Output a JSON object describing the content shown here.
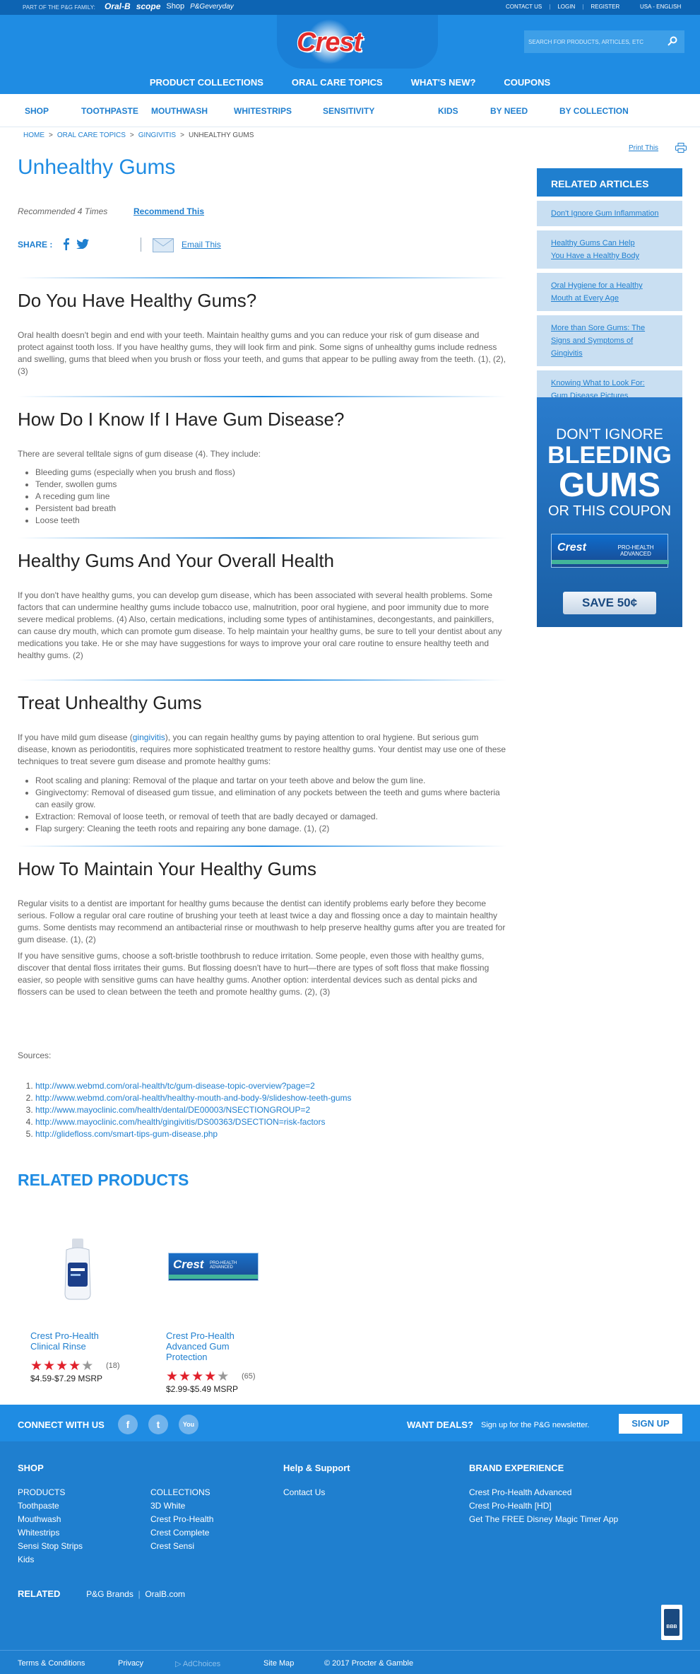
{
  "topbar": {
    "family": "PART OF THE P&G FAMILY:",
    "brands": [
      "Oral-B",
      "scope",
      "Shop",
      "P&Geveryday"
    ],
    "util": [
      "CONTACT US",
      "LOGIN",
      "REGISTER"
    ],
    "locale": "USA - ENGLISH"
  },
  "header": {
    "logo": "Crest",
    "search_placeholder": "SEARCH FOR PRODUCTS, ARTICLES, ETC",
    "nav": [
      "PRODUCT COLLECTIONS",
      "ORAL CARE TOPICS",
      "WHAT'S NEW?",
      "COUPONS"
    ]
  },
  "subnav": [
    "SHOP",
    "TOOTHPASTE",
    "MOUTHWASH",
    "WHITESTRIPS",
    "SENSITIVITY",
    "KIDS",
    "BY NEED",
    "BY COLLECTION"
  ],
  "breadcrumb": [
    "HOME",
    "ORAL CARE TOPICS",
    "GINGIVITIS",
    "UNHEALTHY GUMS"
  ],
  "print": "Print This",
  "article": {
    "title": "Unhealthy Gums",
    "recommended": "Recommended 4 Times",
    "recommend_btn": "Recommend This",
    "share": "SHARE :",
    "email": "Email This",
    "s1": {
      "heading": "Do You Have Healthy Gums?",
      "p": "Oral health doesn't begin and end with your teeth. Maintain healthy gums and you can reduce your risk of gum disease and protect against tooth loss. If you have healthy gums, they will look firm and pink. Some signs of unhealthy gums include redness and swelling, gums that bleed when you brush or floss your teeth, and gums that appear to be pulling away from the teeth. (1), (2), (3)"
    },
    "s2": {
      "heading": "How Do I Know If I Have Gum Disease?",
      "p": "There are several telltale signs of gum disease (4). They include:",
      "items": [
        "Bleeding gums (especially when you brush and floss)",
        "Tender, swollen gums",
        "A receding gum line",
        "Persistent bad breath",
        "Loose teeth"
      ]
    },
    "s3": {
      "heading": "Healthy Gums And Your Overall Health",
      "p": "If you don't have healthy gums, you can develop gum disease, which has been associated with several health problems. Some factors that can undermine healthy gums include tobacco use, malnutrition, poor oral hygiene, and poor immunity due to more severe medical problems. (4) Also, certain medications, including some types of antihistamines, decongestants, and painkillers, can cause dry mouth, which can promote gum disease. To help maintain your healthy gums, be sure to tell your dentist about any medications you take. He or she may have suggestions for ways to improve your oral care routine to ensure healthy teeth and healthy gums. (2)"
    },
    "s4": {
      "heading": "Treat Unhealthy Gums",
      "p_pre": "If you have mild gum disease (",
      "p_link": "gingivitis",
      "p_post": "), you can regain healthy gums by paying attention to oral hygiene. But serious gum disease, known as periodontitis, requires more sophisticated treatment to restore healthy gums. Your dentist may use one of these techniques to treat severe gum disease and promote healthy gums:",
      "items": [
        "Root scaling and planing: Removal of the plaque and tartar on your teeth above and below the gum line.",
        "Gingivectomy: Removal of diseased gum tissue, and elimination of any pockets between the teeth and gums where bacteria can easily grow.",
        "Extraction: Removal of loose teeth, or removal of teeth that are badly decayed or damaged.",
        "Flap surgery: Cleaning the teeth roots and repairing any bone damage. (1), (2)"
      ]
    },
    "s5": {
      "heading": "How To Maintain Your Healthy Gums",
      "p1": "Regular visits to a dentist are important for healthy gums because the dentist can identify problems early before they become serious. Follow a regular oral care routine of brushing your teeth at least twice a day and flossing once a day to maintain healthy gums. Some dentists may recommend an antibacterial rinse or mouthwash to help preserve healthy gums after you are treated for gum disease. (1), (2)",
      "p2": "If you have sensitive gums, choose a soft-bristle toothbrush to reduce irritation. Some people, even those with healthy gums, discover that dental floss irritates their gums. But flossing doesn't have to hurt—there are types of soft floss that make flossing easier, so people with sensitive gums can have healthy gums. Another option: interdental devices such as dental picks and flossers can be used to clean between the teeth and promote healthy gums. (2), (3)"
    },
    "sources_label": "Sources:",
    "sources": [
      "http://www.webmd.com/oral-health/tc/gum-disease-topic-overview?page=2",
      "http://www.webmd.com/oral-health/healthy-mouth-and-body-9/slideshow-teeth-gums",
      "http://www.mayoclinic.com/health/dental/DE00003/NSECTIONGROUP=2",
      "http://www.mayoclinic.com/health/gingivitis/DS00363/DSECTION=risk-factors",
      "http://glidefloss.com/smart-tips-gum-disease.php"
    ]
  },
  "related_products": {
    "heading": "RELATED PRODUCTS",
    "items": [
      {
        "name_l1": "Crest Pro-Health",
        "name_l2": "Clinical Rinse",
        "name_l3": "",
        "rating": 4,
        "count": "(18)",
        "price": "$4.59-$7.29 MSRP"
      },
      {
        "name_l1": "Crest Pro-Health",
        "name_l2": "Advanced Gum",
        "name_l3": "Protection",
        "rating": 4,
        "count": "(65)",
        "price": "$2.99-$5.49 MSRP"
      }
    ],
    "pack_brand": "Crest",
    "pack_sub": "PRO-HEALTH ADVANCED"
  },
  "sidebar": {
    "title": "RELATED ARTICLES",
    "items": [
      "Don't Ignore Gum Inflammation",
      "Healthy Gums Can Help You Have a Healthy Body",
      "Oral Hygiene for a Healthy Mouth at Every Age",
      "More than Sore Gums: The Signs and Symptoms of Gingivitis",
      "Knowing What to Look For: Gum Disease Pictures"
    ],
    "ad": {
      "l1": "DON'T IGNORE",
      "l2": "BLEEDING",
      "l3": "GUMS",
      "l4": "OR THIS COUPON",
      "brand": "Crest",
      "sub": "PRO-HEALTH ADVANCED",
      "cta": "SAVE 50¢"
    }
  },
  "footer": {
    "connect": "CONNECT WITH US",
    "social": [
      "f",
      "t",
      "You"
    ],
    "deals": "WANT DEALS?",
    "deals_sub": "Sign up for the P&G newsletter.",
    "signup": "SIGN UP",
    "shop_heading": "SHOP",
    "shop_col1": [
      "PRODUCTS",
      "Toothpaste",
      "Mouthwash",
      "Whitestrips",
      "Sensi Stop Strips",
      "Kids"
    ],
    "shop_col2": [
      "COLLECTIONS",
      "3D White",
      "Crest Pro-Health",
      "Crest Complete",
      "Crest Sensi"
    ],
    "help_heading": "Help & Support",
    "help_items": [
      "Contact Us"
    ],
    "brand_heading": "BRAND EXPERIENCE",
    "brand_items": [
      "Crest Pro-Health Advanced",
      "Crest Pro-Health [HD]",
      "Get The FREE Disney Magic Timer App"
    ],
    "related_label": "RELATED",
    "related_links": [
      "P&G Brands",
      "OralB.com"
    ],
    "bbb": "BBB",
    "bottom": [
      "Terms & Conditions",
      "Privacy",
      "AdChoices",
      "Site Map",
      "© 2017 Procter & Gamble"
    ]
  },
  "colors": {
    "brand_blue": "#1f8ce3",
    "link_blue": "#1f7fcf",
    "star": "#e0202b"
  }
}
